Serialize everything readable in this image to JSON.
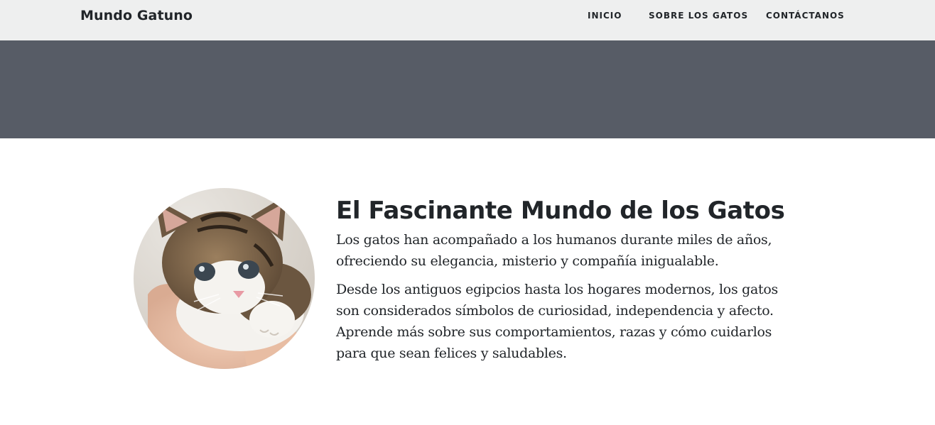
{
  "navbar": {
    "brand": "Mundo Gatuno",
    "links": [
      {
        "label": "INICIO"
      },
      {
        "label": "SOBRE LOS GATOS"
      },
      {
        "label": "CONTÁCTANOS"
      }
    ]
  },
  "main": {
    "title": "El Fascinante Mundo de los Gatos",
    "paragraphs": [
      "Los gatos han acompañado a los humanos durante miles de años, ofreciendo su elegancia, misterio y compañía inigualable.",
      "Desde los antiguos egipcios hasta los hogares modernos, los gatos son considerados símbolos de curiosidad, independencia y afecto. Aprende más sobre sus comportamientos, razas y cómo cuidarlos para que sean felices y saludables."
    ],
    "image": {
      "icon": "kitten-photo"
    }
  },
  "colors": {
    "navbar_bg": "#eeefef",
    "masthead_bg": "#575c66",
    "text": "#212529"
  }
}
